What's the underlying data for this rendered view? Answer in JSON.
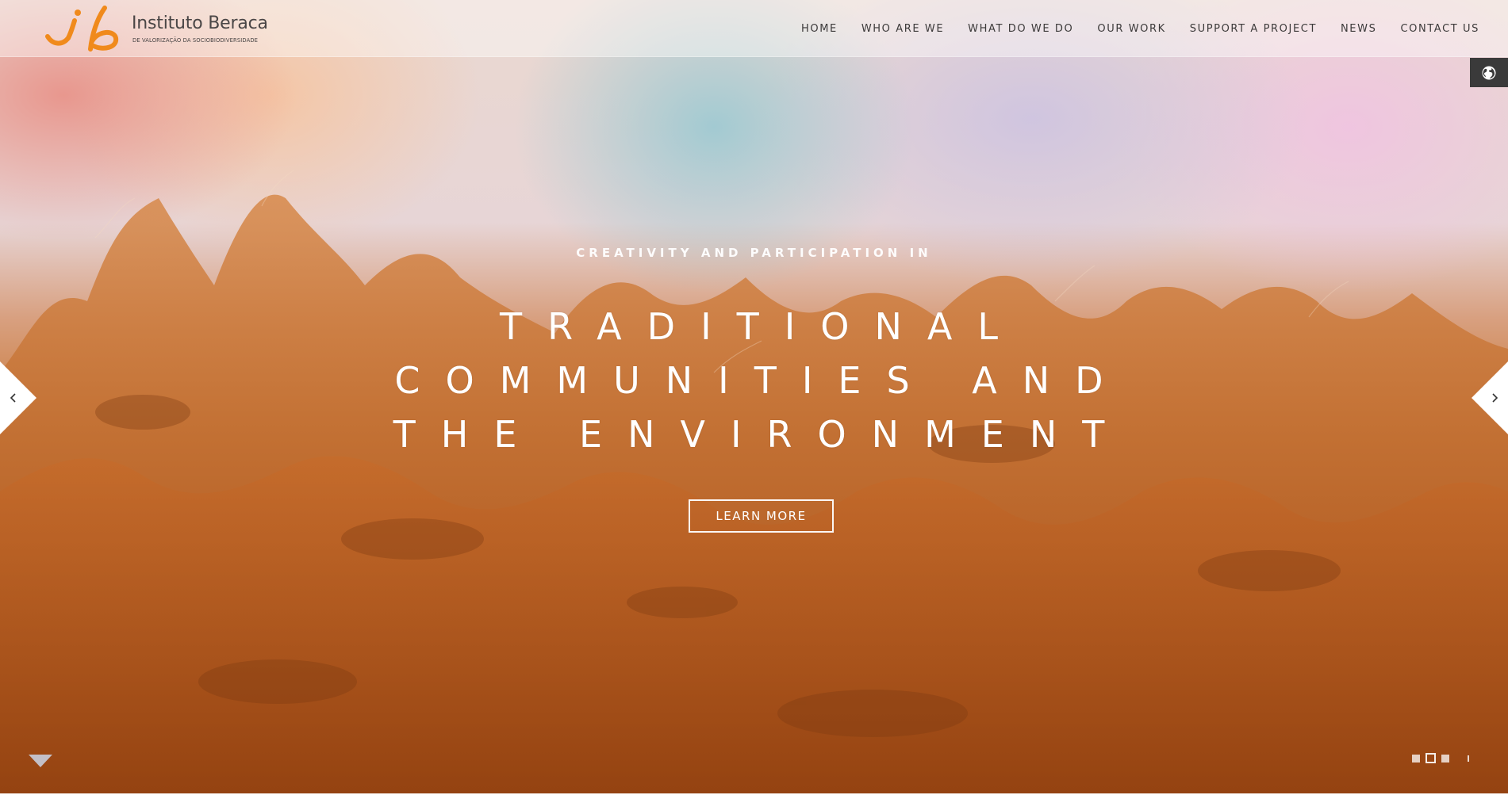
{
  "header": {
    "logo_mark": "ib",
    "logo_title": "Instituto Beraca",
    "logo_subtitle": "DE VALORIZAÇÃO DA SOCIOBIODIVERSIDADE",
    "nav": [
      {
        "label": "HOME"
      },
      {
        "label": "WHO ARE WE"
      },
      {
        "label": "WHAT DO WE DO"
      },
      {
        "label": "OUR WORK"
      },
      {
        "label": "SUPPORT A PROJECT"
      },
      {
        "label": "NEWS"
      },
      {
        "label": "CONTACT US"
      }
    ]
  },
  "language": {
    "icon": "globe-icon"
  },
  "slide": {
    "subtitle": "CREATIVITY AND PARTICIPATION IN",
    "title": "TRADITIONAL COMMUNITIES AND THE ENVIRONMENT",
    "cta_label": "LEARN MORE",
    "prev_icon": "chevron-left-icon",
    "next_icon": "chevron-right-icon",
    "scroll_icon": "triangle-down-icon",
    "total_slides": 3,
    "active_slide": 2
  },
  "colors": {
    "brand_orange": "#f08a1c",
    "nav_text": "#3c3a3a",
    "lang_bg": "#3a3a3a"
  }
}
